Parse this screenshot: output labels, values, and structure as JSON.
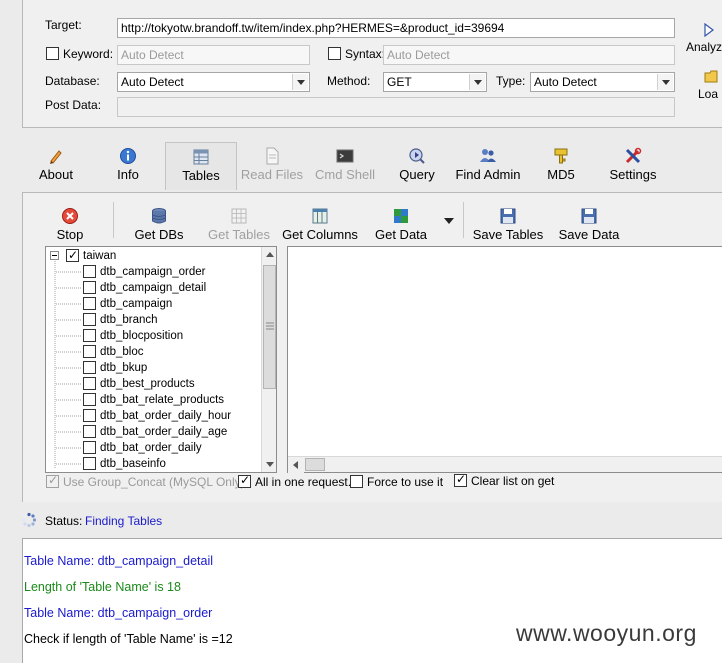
{
  "form": {
    "target_label": "Target:",
    "target_value": "http://tokyotw.brandoff.tw/item/index.php?HERMES=&product_id=39694",
    "keyword_label": "Keyword:",
    "keyword_placeholder": "Auto Detect",
    "syntax_label": "Syntax:",
    "syntax_placeholder": "Auto Detect",
    "database_label": "Database:",
    "database_value": "Auto Detect",
    "method_label": "Method:",
    "method_value": "GET",
    "type_label": "Type:",
    "type_value": "Auto Detect",
    "postdata_label": "Post Data:",
    "analyze_label": "Analyz",
    "load_label": "Loa"
  },
  "toolbar": {
    "about": "About",
    "info": "Info",
    "tables": "Tables",
    "read_files": "Read Files",
    "cmd_shell": "Cmd Shell",
    "query": "Query",
    "find_admin": "Find Admin",
    "md5": "MD5",
    "settings": "Settings"
  },
  "subtoolbar": {
    "stop": "Stop",
    "get_dbs": "Get DBs",
    "get_tables": "Get Tables",
    "get_columns": "Get Columns",
    "get_data": "Get Data",
    "save_tables": "Save Tables",
    "save_data": "Save Data"
  },
  "tree": {
    "root": "taiwan",
    "items": [
      "dtb_campaign_order",
      "dtb_campaign_detail",
      "dtb_campaign",
      "dtb_branch",
      "dtb_blocposition",
      "dtb_bloc",
      "dtb_bkup",
      "dtb_best_products",
      "dtb_bat_relate_products",
      "dtb_bat_order_daily_hour",
      "dtb_bat_order_daily_age",
      "dtb_bat_order_daily",
      "dtb_baseinfo"
    ]
  },
  "options": {
    "group_concat": "Use Group_Concat (MySQL Only)",
    "all_in_one": "All in one request.",
    "force": "Force to use it",
    "clear_list": "Clear list on get"
  },
  "status": {
    "label": "Status:",
    "value": "Finding Tables"
  },
  "log": [
    "Table Name: dtb_campaign_detail",
    "Length of 'Table Name' is 18",
    "Table Name: dtb_campaign_order",
    "Check if length of 'Table Name' is =12"
  ],
  "watermark": "www.wooyun.org",
  "colors": {
    "status_blue": "#1a1acc",
    "log_blue": "#1a1acc",
    "log_green": "#1a8a1a",
    "log_black": "#000000"
  }
}
